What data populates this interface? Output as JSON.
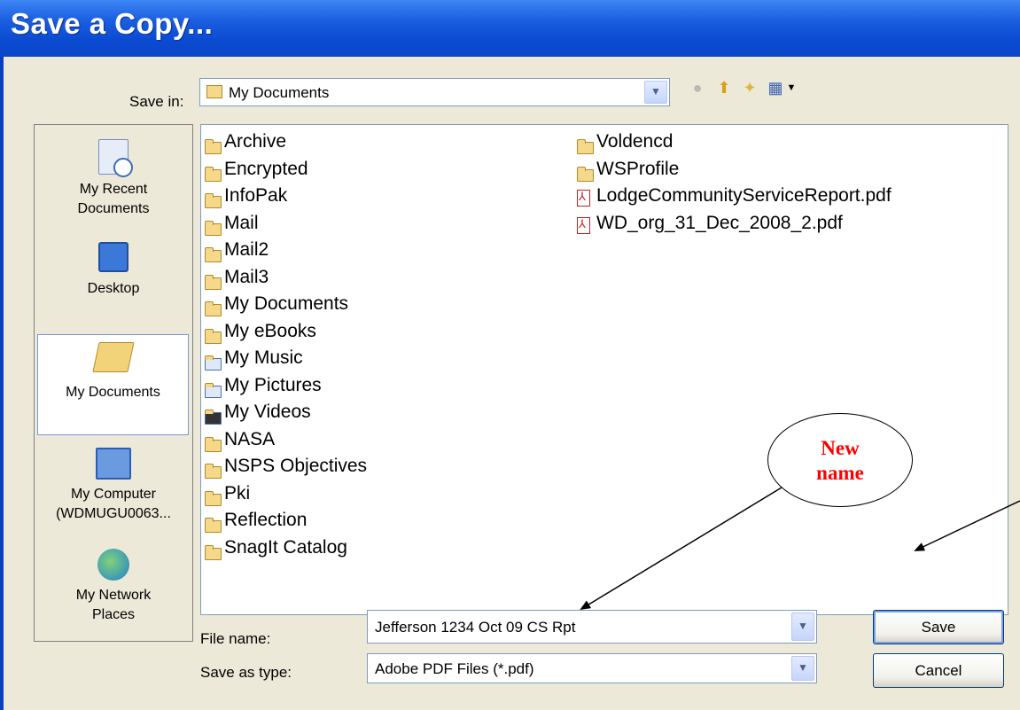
{
  "window": {
    "title": "Save a Copy..."
  },
  "toolbar": {
    "save_in_label": "Save in:",
    "save_in_value": "My Documents",
    "icons": [
      "back-icon",
      "up-folder-icon",
      "new-folder-icon",
      "views-menu-icon"
    ]
  },
  "places": [
    {
      "label_line1": "My Recent",
      "label_line2": "Documents",
      "icon": "recent-documents-icon"
    },
    {
      "label_line1": "Desktop",
      "label_line2": "",
      "icon": "desktop-icon"
    },
    {
      "label_line1": "My Documents",
      "label_line2": "",
      "icon": "my-documents-icon",
      "selected": true
    },
    {
      "label_line1": "My Computer",
      "label_line2": "(WDMUGU0063...",
      "icon": "my-computer-icon"
    },
    {
      "label_line1": "My Network",
      "label_line2": "Places",
      "icon": "network-places-icon"
    }
  ],
  "files": {
    "column1": [
      {
        "name": "Archive",
        "type": "folder"
      },
      {
        "name": "Encrypted",
        "type": "folder"
      },
      {
        "name": "InfoPak",
        "type": "folder"
      },
      {
        "name": "Mail",
        "type": "folder"
      },
      {
        "name": "Mail2",
        "type": "folder"
      },
      {
        "name": "Mail3",
        "type": "folder"
      },
      {
        "name": "My Documents",
        "type": "folder"
      },
      {
        "name": "My eBooks",
        "type": "folder"
      },
      {
        "name": "My Music",
        "type": "music-folder"
      },
      {
        "name": "My Pictures",
        "type": "pictures-folder"
      },
      {
        "name": "My Videos",
        "type": "videos-folder"
      },
      {
        "name": "NASA",
        "type": "folder"
      },
      {
        "name": "NSPS Objectives",
        "type": "folder"
      },
      {
        "name": "Pki",
        "type": "folder"
      },
      {
        "name": "Reflection",
        "type": "folder"
      },
      {
        "name": "SnagIt Catalog",
        "type": "folder"
      }
    ],
    "column2": [
      {
        "name": "Voldencd",
        "type": "folder"
      },
      {
        "name": "WSProfile",
        "type": "folder"
      },
      {
        "name": "LodgeCommunityServiceReport.pdf",
        "type": "pdf"
      },
      {
        "name": "WD_org_31_Dec_2008_2.pdf",
        "type": "pdf"
      }
    ]
  },
  "form": {
    "file_name_label": "File name:",
    "file_name_value": "Jefferson 1234 Oct 09 CS Rpt",
    "type_label": "Save as type:",
    "type_value": "Adobe PDF Files (*.pdf)"
  },
  "buttons": {
    "save": "Save",
    "cancel": "Cancel"
  },
  "annotation": {
    "line1": "New",
    "line2": "name",
    "color": "#ff0000"
  },
  "colors": {
    "titlebar": "#0b4bd2",
    "dialog_bg": "#ece9d8"
  }
}
